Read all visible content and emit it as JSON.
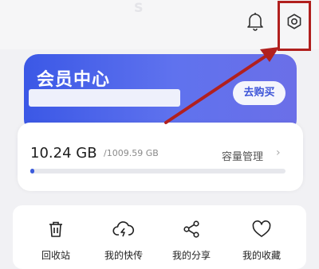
{
  "header": {
    "ghost_title": "S"
  },
  "vip": {
    "title": "会员中心",
    "buy_label": "去购买"
  },
  "storage": {
    "used": "10.24 GB",
    "total": "/1009.59 GB",
    "manage_label": "容量管理",
    "chevron": "›",
    "fraction_used": 0.0101
  },
  "tools": [
    {
      "label": "回收站",
      "icon": "trash-icon"
    },
    {
      "label": "我的快传",
      "icon": "cloud-transfer-icon"
    },
    {
      "label": "我的分享",
      "icon": "share-icon"
    },
    {
      "label": "我的收藏",
      "icon": "heart-icon"
    }
  ],
  "colors": {
    "accent": "#3b5bdb",
    "annotation": "#b1201e"
  }
}
